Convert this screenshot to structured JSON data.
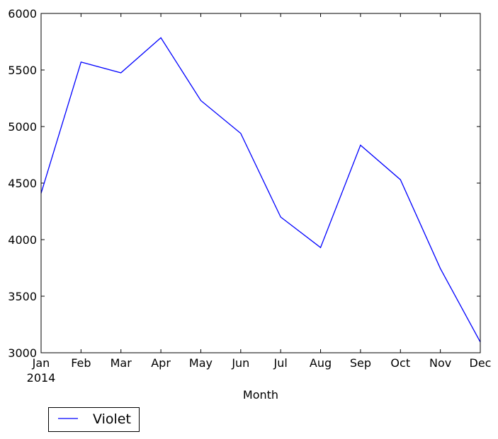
{
  "chart_data": {
    "type": "line",
    "title": "",
    "xlabel": "Month",
    "ylabel": "",
    "x": [
      "Jan",
      "Feb",
      "Mar",
      "Apr",
      "May",
      "Jun",
      "Jul",
      "Aug",
      "Sep",
      "Oct",
      "Nov",
      "Dec"
    ],
    "x_sublabel": "2014",
    "ylim": [
      3000,
      6000
    ],
    "yticks": [
      3000,
      3500,
      4000,
      4500,
      5000,
      5500,
      6000
    ],
    "yticklabels": [
      "3000",
      "3500",
      "4000",
      "4500",
      "5000",
      "5500",
      "6000"
    ],
    "grid": false,
    "legend": {
      "position": "below-left",
      "entries": [
        "Violet"
      ]
    },
    "series": [
      {
        "name": "Violet",
        "color": "#0000ff",
        "values": [
          4410,
          5570,
          5475,
          5785,
          5230,
          4940,
          4200,
          3930,
          4835,
          4530,
          3745,
          3095
        ]
      }
    ]
  }
}
